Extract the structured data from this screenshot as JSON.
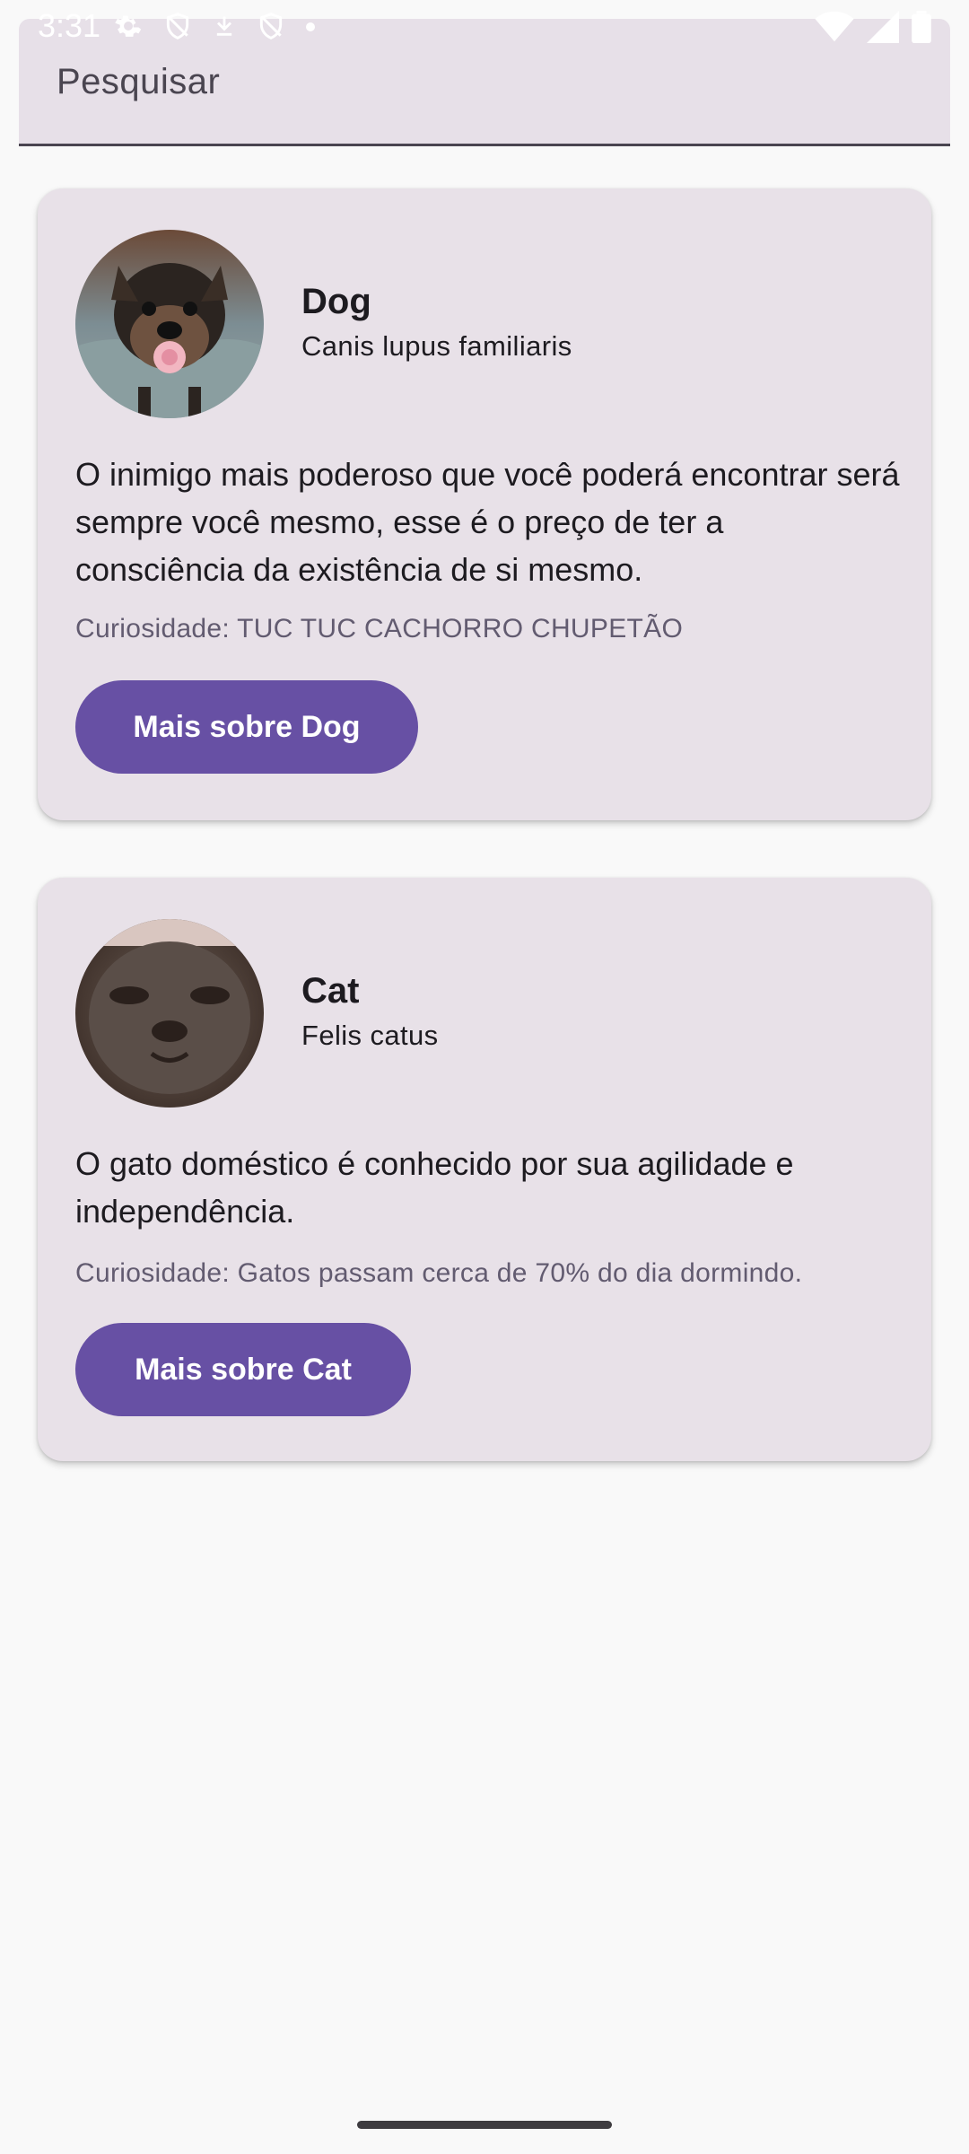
{
  "status_bar": {
    "time": "3:31",
    "left_icons": [
      "gear-icon",
      "shield-icon",
      "download-icon",
      "shield-icon",
      "dot-icon"
    ],
    "right_icons": [
      "wifi-icon",
      "signal-icon",
      "battery-icon"
    ]
  },
  "search": {
    "placeholder": "Pesquisar"
  },
  "animals": [
    {
      "name": "Dog",
      "scientific_name": "Canis lupus familiaris",
      "description": "O inimigo mais poderoso que você poderá encontrar será sempre você mesmo, esse é o preço de ter a consciência da existência de si mesmo.",
      "fact": "Curiosidade: TUC TUC CACHORRO CHUPETÃO",
      "button_label": "Mais sobre Dog",
      "avatar_icon": "dog-photo"
    },
    {
      "name": "Cat",
      "scientific_name": "Felis catus",
      "description": "O gato doméstico é conhecido por sua agilidade e independência.",
      "fact": "Curiosidade: Gatos passam cerca de 70% do dia dormindo.",
      "button_label": "Mais sobre Cat",
      "avatar_icon": "cat-photo"
    }
  ],
  "colors": {
    "background": "#f9f9f9",
    "card": "#e8e1e8",
    "primary": "#6750a4",
    "on_primary": "#ffffff",
    "secondary_text": "#625b70"
  }
}
